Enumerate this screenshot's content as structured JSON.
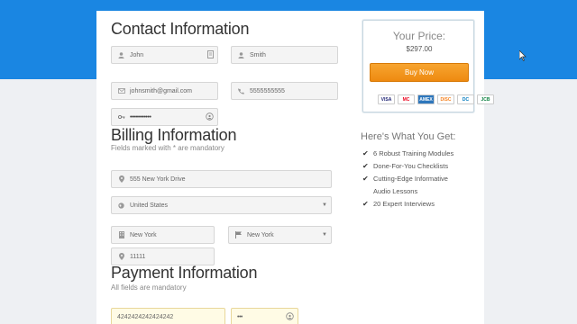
{
  "contact": {
    "heading": "Contact Information",
    "first_name": "John",
    "last_name": "Smith",
    "email": "johnsmith@gmail.com",
    "phone": "5555555555",
    "password": "••••••••••••"
  },
  "billing": {
    "heading": "Billing Information",
    "note": "Fields marked with * are mandatory",
    "address": "555 New York Drive",
    "country": "United States",
    "city": "New York",
    "state": "New York",
    "zip": "11111"
  },
  "payment": {
    "heading": "Payment Information",
    "note": "All fields are mandatory",
    "card_number": "4242424242424242",
    "cvv": "•••"
  },
  "price": {
    "title": "Your Price:",
    "amount": "$297.00",
    "buy_label": "Buy Now",
    "cards": [
      "VISA",
      "MC",
      "AMEX",
      "DISC",
      "DC",
      "JCB"
    ]
  },
  "benefits": {
    "title": "Here's What You Get:",
    "items": [
      "6 Robust Training Modules",
      "Done-For-You Checklists",
      "Cutting-Edge Informative",
      "Audio Lessons",
      "20 Expert Interviews"
    ]
  },
  "colors": {
    "top_band": "#1a86e2",
    "buy_button": "#f29a1f"
  }
}
